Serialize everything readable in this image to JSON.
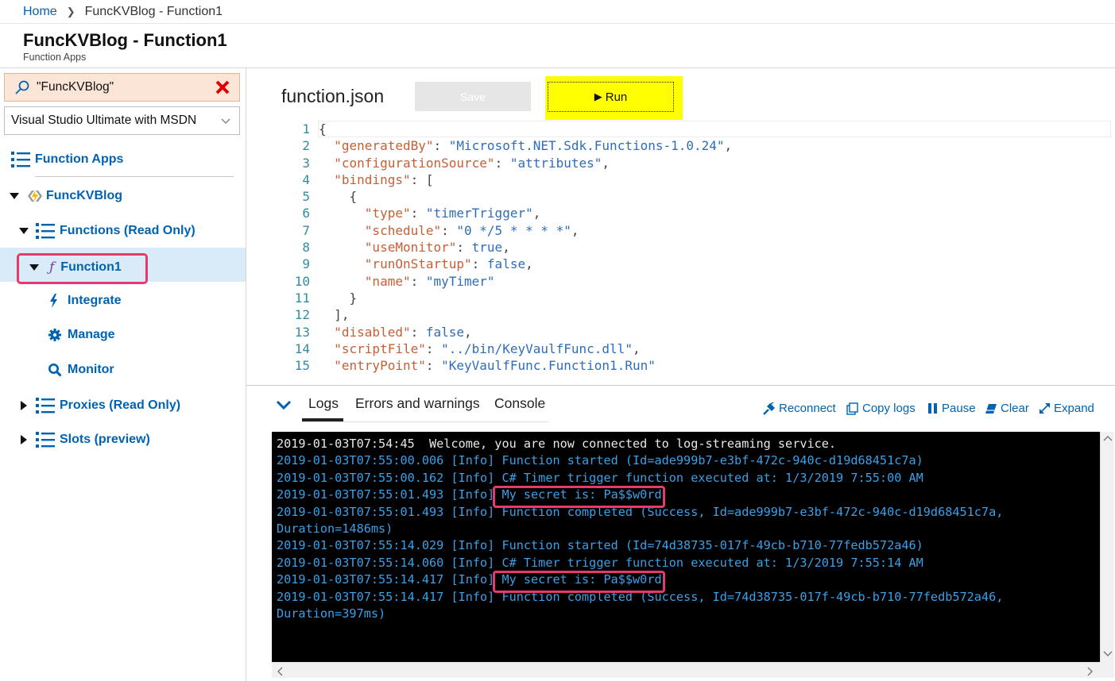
{
  "breadcrumb": {
    "home": "Home",
    "current": "FuncKVBlog - Function1"
  },
  "header": {
    "title": "FuncKVBlog - Function1",
    "subtitle": "Function Apps"
  },
  "sidebar": {
    "search_value": "\"FuncKVBlog\"",
    "subscription": "Visual Studio Ultimate with MSDN",
    "function_apps": "Function Apps",
    "app_name": "FuncKVBlog",
    "functions": "Functions (Read Only)",
    "function1": "Function1",
    "integrate": "Integrate",
    "manage": "Manage",
    "monitor": "Monitor",
    "proxies": "Proxies (Read Only)",
    "slots": "Slots (preview)"
  },
  "editor": {
    "file_name": "function.json",
    "save_label": "Save",
    "run_label": "Run",
    "lines": [
      {
        "n": "1",
        "parts": [
          [
            "p",
            "{"
          ]
        ]
      },
      {
        "n": "2",
        "parts": [
          [
            "p",
            "  "
          ],
          [
            "k",
            "\"generatedBy\""
          ],
          [
            "p",
            ": "
          ],
          [
            "s",
            "\"Microsoft.NET.Sdk.Functions-1.0.24\""
          ],
          [
            "p",
            ","
          ]
        ]
      },
      {
        "n": "3",
        "parts": [
          [
            "p",
            "  "
          ],
          [
            "k",
            "\"configurationSource\""
          ],
          [
            "p",
            ": "
          ],
          [
            "s",
            "\"attributes\""
          ],
          [
            "p",
            ","
          ]
        ]
      },
      {
        "n": "4",
        "parts": [
          [
            "p",
            "  "
          ],
          [
            "k",
            "\"bindings\""
          ],
          [
            "p",
            ": ["
          ]
        ]
      },
      {
        "n": "5",
        "parts": [
          [
            "p",
            "    {"
          ]
        ]
      },
      {
        "n": "6",
        "parts": [
          [
            "p",
            "      "
          ],
          [
            "k",
            "\"type\""
          ],
          [
            "p",
            ": "
          ],
          [
            "s",
            "\"timerTrigger\""
          ],
          [
            "p",
            ","
          ]
        ]
      },
      {
        "n": "7",
        "parts": [
          [
            "p",
            "      "
          ],
          [
            "k",
            "\"schedule\""
          ],
          [
            "p",
            ": "
          ],
          [
            "s",
            "\"0 */5 * * * *\""
          ],
          [
            "p",
            ","
          ]
        ]
      },
      {
        "n": "8",
        "parts": [
          [
            "p",
            "      "
          ],
          [
            "k",
            "\"useMonitor\""
          ],
          [
            "p",
            ": "
          ],
          [
            "s",
            "true"
          ],
          [
            "p",
            ","
          ]
        ]
      },
      {
        "n": "9",
        "parts": [
          [
            "p",
            "      "
          ],
          [
            "k",
            "\"runOnStartup\""
          ],
          [
            "p",
            ": "
          ],
          [
            "s",
            "false"
          ],
          [
            "p",
            ","
          ]
        ]
      },
      {
        "n": "10",
        "parts": [
          [
            "p",
            "      "
          ],
          [
            "k",
            "\"name\""
          ],
          [
            "p",
            ": "
          ],
          [
            "s",
            "\"myTimer\""
          ]
        ]
      },
      {
        "n": "11",
        "parts": [
          [
            "p",
            "    }"
          ]
        ]
      },
      {
        "n": "12",
        "parts": [
          [
            "p",
            "  ],"
          ]
        ]
      },
      {
        "n": "13",
        "parts": [
          [
            "p",
            "  "
          ],
          [
            "k",
            "\"disabled\""
          ],
          [
            "p",
            ": "
          ],
          [
            "s",
            "false"
          ],
          [
            "p",
            ","
          ]
        ]
      },
      {
        "n": "14",
        "parts": [
          [
            "p",
            "  "
          ],
          [
            "k",
            "\"scriptFile\""
          ],
          [
            "p",
            ": "
          ],
          [
            "s",
            "\"../bin/KeyVaulfFunc.dll\""
          ],
          [
            "p",
            ","
          ]
        ]
      },
      {
        "n": "15",
        "parts": [
          [
            "p",
            "  "
          ],
          [
            "k",
            "\"entryPoint\""
          ],
          [
            "p",
            ": "
          ],
          [
            "s",
            "\"KeyVaulfFunc.Function1.Run\""
          ]
        ]
      }
    ]
  },
  "logs": {
    "tabs": [
      "Logs",
      "Errors and warnings",
      "Console"
    ],
    "actions": {
      "reconnect": "Reconnect",
      "copy": "Copy logs",
      "pause": "Pause",
      "clear": "Clear",
      "expand": "Expand"
    },
    "lines": [
      {
        "text": "2019-01-03T07:54:45  Welcome, you are now connected to log-streaming service.",
        "color": "white"
      },
      {
        "text": "2019-01-03T07:55:00.006 [Info] Function started (Id=ade999b7-e3bf-472c-940c-d19d68451c7a)",
        "color": "blue"
      },
      {
        "text": "2019-01-03T07:55:00.162 [Info] C# Timer trigger function executed at: 1/3/2019 7:55:00 AM",
        "color": "blue"
      },
      {
        "text": "2019-01-03T07:55:01.493 [Info] My secret is: Pa$$w0rd",
        "color": "blue"
      },
      {
        "text": "2019-01-03T07:55:01.493 [Info] Function completed (Success, Id=ade999b7-e3bf-472c-940c-d19d68451c7a,",
        "color": "blue"
      },
      {
        "text": "Duration=1486ms)",
        "color": "blue"
      },
      {
        "text": "2019-01-03T07:55:14.029 [Info] Function started (Id=74d38735-017f-49cb-b710-77fedb572a46)",
        "color": "blue"
      },
      {
        "text": "2019-01-03T07:55:14.060 [Info] C# Timer trigger function executed at: 1/3/2019 7:55:14 AM",
        "color": "blue"
      },
      {
        "text": "2019-01-03T07:55:14.417 [Info] My secret is: Pa$$w0rd",
        "color": "blue"
      },
      {
        "text": "2019-01-03T07:55:14.417 [Info] Function completed (Success, Id=74d38735-017f-49cb-b710-77fedb572a46,",
        "color": "blue"
      },
      {
        "text": "Duration=397ms)",
        "color": "blue"
      }
    ]
  },
  "colors": {
    "accent": "#0063b1",
    "highlight": "#ffff00",
    "annotation": "#e8396b",
    "log_blue": "#3aa0e8"
  }
}
